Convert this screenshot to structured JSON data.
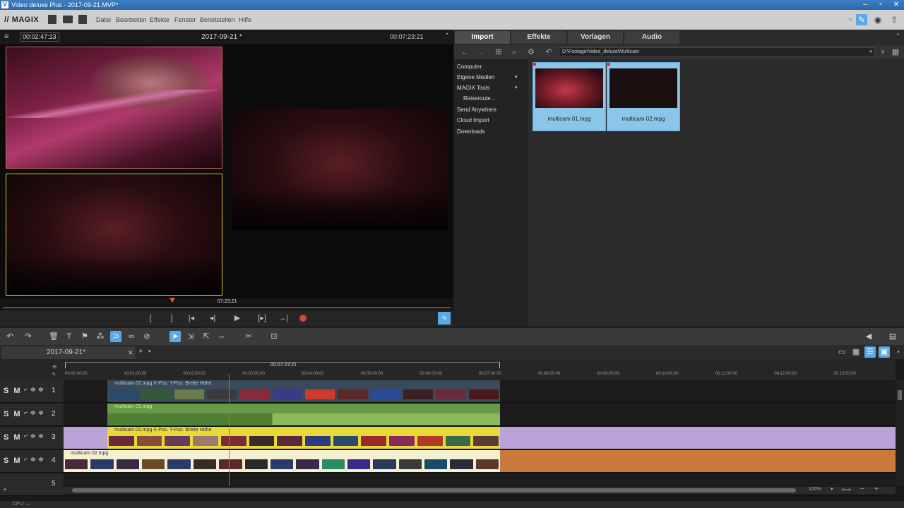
{
  "window": {
    "title": "Video deluxe Plus - 2017-09-21.MVP*"
  },
  "brand": {
    "logo": "MAGIX"
  },
  "menu": {
    "items": [
      "Datei",
      "Bearbeiten",
      "Effekte",
      "Fenster",
      "Bereitstellen",
      "Hilfe"
    ]
  },
  "preview": {
    "timecode_left": "00:02:47:13",
    "title": "2017-09-21 *",
    "timecode_right": "00:07:23:21",
    "scrub_time": "07:23:21"
  },
  "pool": {
    "tabs": [
      "Import",
      "Effekte",
      "Vorlagen",
      "Audio"
    ],
    "path": "D:\\Footage\\Video_deluxe\\Multicam",
    "tree": [
      "Computer",
      "Eigene Medien",
      "MAGIX Tools",
      "Reiseroute...",
      "Send Anywhere",
      "Cloud Import",
      "Downloads"
    ],
    "files": [
      "multicam 01.mpg",
      "multicam 02.mpg"
    ]
  },
  "timeline": {
    "project_tab": "2017-09-21*",
    "range_time": "00:07:23:21",
    "ticks": [
      "00:00:00:00",
      "00:01:00:00",
      "00:02:00:00",
      "00:03:00:00",
      "00:04:00:00",
      "00:05:00:00",
      "00:06:00:00",
      "00:07:00:00",
      "00:08:00:00",
      "00:09:00:00",
      "00:10:00:00",
      "00:11:00:00",
      "00:12:00:00",
      "00:13:00:00"
    ],
    "tracks": [
      {
        "smx": "S M",
        "num": "1",
        "clip": "multicam 02.mpg   X-Pos.  Y-Pos.  Breite  Höhe"
      },
      {
        "smx": "S M",
        "num": "2",
        "clip": "multicam 01.mpg"
      },
      {
        "smx": "S M",
        "num": "3",
        "clip": "multicam 01.mpg   X-Pos.  Y-Pos.  Breite  Höhe"
      },
      {
        "smx": "S M",
        "num": "4",
        "clip": "multicam 02.mpg"
      },
      {
        "smx": "",
        "num": "5",
        "clip": ""
      }
    ],
    "zoom": "100%"
  },
  "status": {
    "text": "CPU: —"
  },
  "colors": {
    "accent": "#5aa9e6",
    "record": "#d9453a",
    "track3_bg": "#b9a3d8",
    "track4_bg": "#c87a3a",
    "yellow_clip": "#e8d83a",
    "audio_green": "#6a9a48"
  }
}
